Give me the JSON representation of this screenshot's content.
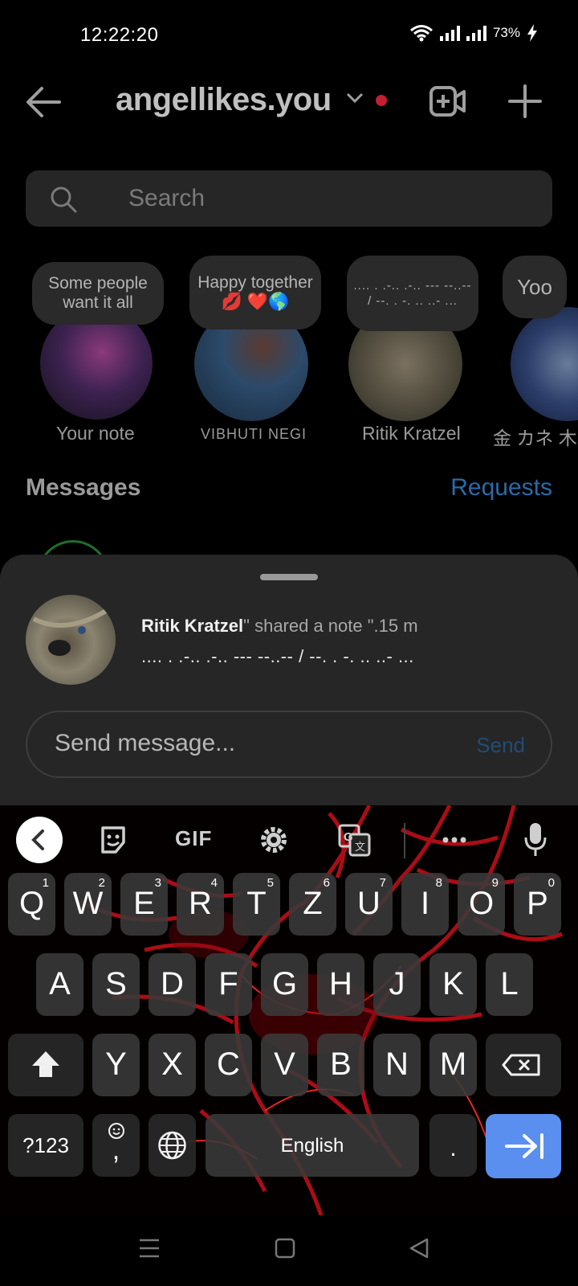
{
  "status": {
    "time": "12:22:20",
    "battery": "73%"
  },
  "header": {
    "account": "angellikes.you"
  },
  "search": {
    "placeholder": "Search"
  },
  "notes": [
    {
      "bubble": "Some people want it all",
      "name": "Your note"
    },
    {
      "bubble": "Happy together 💋 ❤️🌎",
      "name": "VIBHUTI NEGI"
    },
    {
      "bubble": ".... . .-.. .-.. --- --..-- / --. . -. .. ..- ...",
      "name": "Ritik Kratzel"
    },
    {
      "bubble": "Yoo",
      "name": "金 カネ 木"
    }
  ],
  "messages": {
    "title": "Messages",
    "requests": "Requests"
  },
  "sheet": {
    "author": "Ritik Kratzel",
    "shared_text": "\" shared a note \".15 m",
    "note_text": ".... . .-.. .-.. --- --..-- / --. . -. .. ..- ...",
    "input_placeholder": "Send message...",
    "send_label": "Send"
  },
  "keyboard": {
    "toolbar": {
      "gif": "GIF"
    },
    "row1": [
      {
        "k": "Q",
        "n": "1"
      },
      {
        "k": "W",
        "n": "2"
      },
      {
        "k": "E",
        "n": "3"
      },
      {
        "k": "R",
        "n": "4"
      },
      {
        "k": "T",
        "n": "5"
      },
      {
        "k": "Z",
        "n": "6"
      },
      {
        "k": "U",
        "n": "7"
      },
      {
        "k": "I",
        "n": "8"
      },
      {
        "k": "O",
        "n": "9"
      },
      {
        "k": "P",
        "n": "0"
      }
    ],
    "row2": [
      "A",
      "S",
      "D",
      "F",
      "G",
      "H",
      "J",
      "K",
      "L"
    ],
    "row3": [
      "Y",
      "X",
      "C",
      "V",
      "B",
      "N",
      "M"
    ],
    "symbols": "?123",
    "comma": ",",
    "space": "English",
    "period": "."
  },
  "icons": {
    "back": "back-arrow-icon",
    "video": "video-add-icon",
    "plus": "plus-icon",
    "search": "search-icon"
  }
}
